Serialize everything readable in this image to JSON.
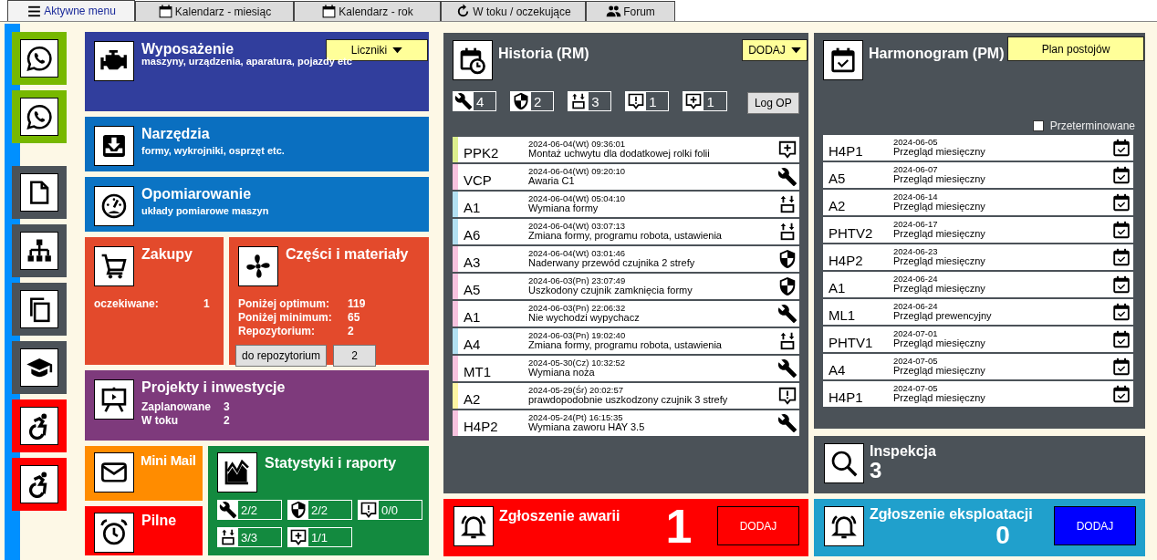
{
  "tabs": [
    {
      "label": "Aktywne menu",
      "kind": "menu",
      "selected": true
    },
    {
      "label": "Kalendarz - miesiąc",
      "kind": "calendar",
      "selected": false
    },
    {
      "label": "Kalendarz - rok",
      "kind": "calendar",
      "selected": false
    },
    {
      "label": "W toku / oczekujące",
      "kind": "refresh",
      "selected": false
    },
    {
      "label": "Forum",
      "kind": "users",
      "selected": false
    }
  ],
  "sidebar": [
    {
      "kind": "whatsapp",
      "color": "#77b800"
    },
    {
      "kind": "whatsapp",
      "color": "#77b800"
    },
    {
      "kind": "document",
      "color": "#4b5258"
    },
    {
      "kind": "org",
      "color": "#4b5258"
    },
    {
      "kind": "copy",
      "color": "#4b5258"
    },
    {
      "kind": "cap",
      "color": "#4b5258"
    },
    {
      "kind": "wheelchair",
      "color": "#ff0000"
    },
    {
      "kind": "wheelchair",
      "color": "#ff0000"
    }
  ],
  "equipment": {
    "title": "Wyposażenie",
    "subtitle": "maszyny, urządzenia, aparatura, pojazdy etc",
    "button": "Liczniki"
  },
  "tools": {
    "title": "Narzędzia",
    "subtitle": "formy, wykrojniki, osprzęt etc."
  },
  "metering": {
    "title": "Opomiarowanie",
    "subtitle": "układy pomiarowe maszyn"
  },
  "purchases": {
    "title": "Zakupy",
    "stats": [
      {
        "label": "oczekiwane:",
        "value": "1"
      }
    ]
  },
  "parts": {
    "title": "Części i materiały",
    "stats": [
      {
        "label": "Poniżej optimum:",
        "value": "119"
      },
      {
        "label": "Poniżej minimum:",
        "value": "65"
      },
      {
        "label": "Repozytorium:",
        "value": "2"
      }
    ],
    "button": "do repozytorium",
    "count": "2"
  },
  "projects": {
    "title": "Projekty i inwestycje",
    "stats": [
      {
        "label": "Zaplanowane",
        "value": "3"
      },
      {
        "label": "W toku",
        "value": "2"
      }
    ]
  },
  "mini_mail": {
    "title": "Mini Mail"
  },
  "urgent": {
    "title": "Pilne"
  },
  "statistics": {
    "title": "Statystyki i raporty",
    "counters": [
      {
        "kind": "wrench",
        "value": "2/2"
      },
      {
        "kind": "shield",
        "value": "2/2"
      },
      {
        "kind": "alert",
        "value": "0/0"
      },
      {
        "kind": "changeover",
        "value": "3/3"
      },
      {
        "kind": "plus",
        "value": "1/1"
      }
    ]
  },
  "history": {
    "title": "Historia (RM)",
    "button": "DODAJ",
    "log_button": "Log OP",
    "counters": [
      {
        "kind": "wrench",
        "value": "4"
      },
      {
        "kind": "shield",
        "value": "2"
      },
      {
        "kind": "changeover",
        "value": "3"
      },
      {
        "kind": "alert",
        "value": "1"
      },
      {
        "kind": "plus",
        "value": "1"
      }
    ],
    "rows": [
      {
        "machine": "PPK2",
        "time": "2024-06-04(Wt) 09:36:01",
        "description": "Montaż uchwytu dla dodatkowej rolki folii",
        "kind": "plus",
        "color": "#dcef8e"
      },
      {
        "machine": "VCP",
        "time": "2024-06-04(Wt) 09:20:10",
        "description": "Awaria C1",
        "kind": "wrench",
        "color": "#f7c3df"
      },
      {
        "machine": "A1",
        "time": "2024-06-04(Wt) 05:04:10",
        "description": "Wymiana formy",
        "kind": "changeover",
        "color": "#b3e0f2"
      },
      {
        "machine": "A6",
        "time": "2024-06-04(Wt) 03:07:13",
        "description": "Zmiana formy, programu robota, ustawienia",
        "kind": "changeover",
        "color": "#b3e0f2"
      },
      {
        "machine": "A3",
        "time": "2024-06-04(Wt) 03:01:46",
        "description": "Naderwany przewód czujnika 2 strefy",
        "kind": "shield",
        "color": "#f7c3df"
      },
      {
        "machine": "A5",
        "time": "2024-06-03(Pn) 23:07:49",
        "description": "Uszkodony czujnik zamknięcia formy",
        "kind": "shield",
        "color": "#f7c3df"
      },
      {
        "machine": "A1",
        "time": "2024-06-03(Pn) 22:06:32",
        "description": "Nie wychodzi wypychacz",
        "kind": "wrench",
        "color": "#f7c3df"
      },
      {
        "machine": "A4",
        "time": "2024-06-03(Pn) 19:02:40",
        "description": "Zmiana formy, programu robota, ustawienia",
        "kind": "changeover",
        "color": "#b3e0f2"
      },
      {
        "machine": "MT1",
        "time": "2024-05-30(Cz) 10:32:52",
        "description": "Wymiana noża",
        "kind": "wrench",
        "color": "#f7c3df"
      },
      {
        "machine": "A2",
        "time": "2024-05-29(Śr) 20:02:57",
        "description": "prawdopodobnie uszkodzony czujnik 3 strefy",
        "kind": "alert",
        "color": "#fdf5a3"
      },
      {
        "machine": "H4P2",
        "time": "2024-05-24(Pt) 16:15:35",
        "description": "Wymiana zaworu HAY 3.5",
        "kind": "wrench",
        "color": "#f7c3df"
      }
    ]
  },
  "schedule": {
    "title": "Harmonogram (PM)",
    "button": "Plan postojów",
    "overdue": {
      "label": "Przeterminowane",
      "checked": false
    },
    "rows": [
      {
        "machine": "H4P1",
        "date": "2024-06-05",
        "description": "Przegląd miesięczny"
      },
      {
        "machine": "A5",
        "date": "2024-06-07",
        "description": "Przegląd miesięczny"
      },
      {
        "machine": "A2",
        "date": "2024-06-14",
        "description": "Przegląd miesięczny"
      },
      {
        "machine": "PHTV2",
        "date": "2024-06-17",
        "description": "Przegląd miesięczny"
      },
      {
        "machine": "H4P2",
        "date": "2024-06-23",
        "description": "Przegląd miesięczny"
      },
      {
        "machine": "A1",
        "date": "2024-06-24",
        "description": "Przegląd miesięczny"
      },
      {
        "machine": "ML1",
        "date": "2024-06-24",
        "description": "Przegląd prewencyjny"
      },
      {
        "machine": "PHTV1",
        "date": "2024-07-01",
        "description": "Przegląd miesięczny"
      },
      {
        "machine": "A4",
        "date": "2024-07-05",
        "description": "Przegląd miesięczny"
      },
      {
        "machine": "H4P1",
        "date": "2024-07-05",
        "description": "Przegląd miesięczny"
      }
    ]
  },
  "inspection": {
    "title": "Inspekcja",
    "count": "3"
  },
  "failure_report": {
    "title": "Zgłoszenie awarii",
    "count": "1",
    "button": "DODAJ"
  },
  "operation_report": {
    "title": "Zgłoszenie eksploatacji",
    "count": "0",
    "button": "DODAJ"
  }
}
